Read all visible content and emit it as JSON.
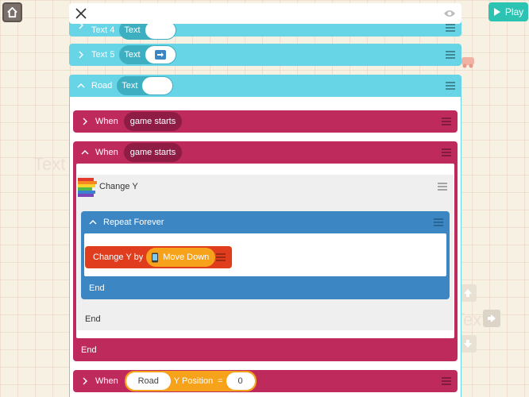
{
  "toolbar": {
    "play_label": "Play"
  },
  "background": {
    "ghost_texts": [
      "Text",
      "Text"
    ]
  },
  "rows": {
    "text4": {
      "label": "Text 4",
      "pill": "Text"
    },
    "text5": {
      "label": "Text 5",
      "pill": "Text"
    },
    "road": {
      "label": "Road",
      "pill": "Text"
    }
  },
  "rules": {
    "rule1": {
      "when": "When",
      "event": "game starts"
    },
    "rule2": {
      "when": "When",
      "event": "game starts",
      "end": "End"
    },
    "change_y": {
      "label": "Change Y",
      "end": "End"
    },
    "repeat": {
      "label": "Repeat Forever",
      "end": "End"
    },
    "change_y_by": {
      "label": "Change Y by",
      "value": "Move Down"
    },
    "rule3": {
      "when": "When",
      "object": "Road",
      "property": "Y Position",
      "operator": "=",
      "value": "0"
    }
  },
  "colors": {
    "cyan": "#67d5e6",
    "magenta": "#bf2a5c",
    "blue": "#3c86c4",
    "red": "#e03d1f",
    "orange": "#f7a21b",
    "teal": "#2dc3b3"
  },
  "icons": [
    "home-icon",
    "play-icon",
    "close-icon",
    "eye-icon",
    "menu-icon",
    "chevron-right-icon",
    "chevron-up-icon",
    "arrow-right-icon",
    "arrow-up-icon",
    "arrow-down-icon",
    "phone-icon",
    "car-icon",
    "rainbow-icon"
  ]
}
